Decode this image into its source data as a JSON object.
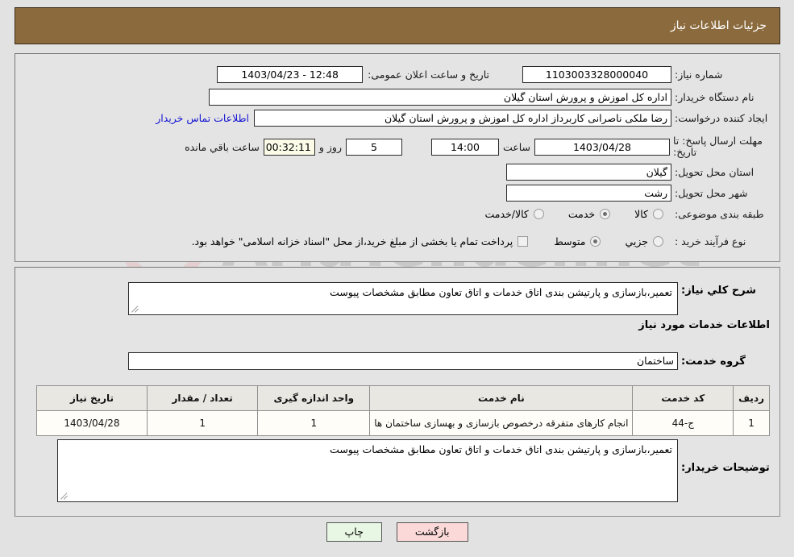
{
  "header": {
    "title": "جزئیات اطلاعات نیاز"
  },
  "watermark": {
    "text": "AriaTender.net",
    "shield_color": "#e8a6a6",
    "text_color": "#8e8e8e"
  },
  "form": {
    "need_number": {
      "label": "شماره نیاز:",
      "value": "1103003328000040"
    },
    "public_announce_datetime": {
      "label": "تاریخ و ساعت اعلان عمومی:",
      "value": "12:48 - 1403/04/23"
    },
    "buyer_org": {
      "label": "نام دستگاه خریدار:",
      "value": "اداره کل اموزش و پرورش استان گیلان"
    },
    "request_creator": {
      "label": "ایجاد کننده درخواست:",
      "value": "رضا ملکی ناصرانی کاربرداز اداره کل اموزش و پرورش استان گیلان"
    },
    "buyer_contact_link": {
      "label": "اطلاعات تماس خریدار"
    },
    "response_deadline": {
      "label": "مهلت ارسال پاسخ: تا تاریخ:",
      "date": "1403/04/28",
      "time_word": "ساعت",
      "time": "14:00",
      "days": "5",
      "days_word": "روز و",
      "timer": "00:32:11",
      "remaining_word": "ساعت باقي مانده"
    },
    "delivery_province": {
      "label": "استان محل تحویل:",
      "value": "گیلان"
    },
    "delivery_city": {
      "label": "شهر محل تحویل:",
      "value": "رشت"
    },
    "subject_category": {
      "label": "طبقه بندی موضوعی:",
      "options": [
        {
          "label": "کالا",
          "checked": false
        },
        {
          "label": "خدمت",
          "checked": true
        },
        {
          "label": "کالا/خدمت",
          "checked": false
        }
      ]
    },
    "purchase_process_type": {
      "label": "نوع فرآیند خرید :",
      "options": [
        {
          "label": "جزیي",
          "checked": false
        },
        {
          "label": "متوسط",
          "checked": true
        }
      ],
      "checkbox": {
        "label": "پرداخت تمام یا بخشی از مبلغ خرید،از محل \"اسناد خزانه اسلامی\" خواهد بود.",
        "checked": false
      }
    }
  },
  "bottom": {
    "general_description": {
      "label": "شرح کلي نیاز:",
      "value": "تعمیر،بازسازی و پارتیشن بندی اتاق خدمات و اتاق تعاون مطابق مشخصات پیوست"
    },
    "services_info_heading": "اطلاعات خدمات مورد نیاز",
    "service_group": {
      "label": "گروه خدمت:",
      "value": "ساختمان"
    },
    "buyer_notes": {
      "label": "توضیحات خریدار:",
      "value": "تعمیر،بازسازی و پارتیشن بندی اتاق خدمات و اتاق تعاون مطابق مشخصات پیوست"
    }
  },
  "table": {
    "columns": [
      "ردیف",
      "کد خدمت",
      "نام خدمت",
      "واحد اندازه گیری",
      "تعداد / مقدار",
      "تاریخ نیاز"
    ],
    "rows": [
      {
        "radif": "1",
        "code": "ج-44",
        "name": "انجام کارهای متفرقه درخصوص بازسازی و بهسازی ساختمان ها",
        "unit": "1",
        "quantity": "1",
        "need_date": "1403/04/28"
      }
    ]
  },
  "buttons": {
    "print": "چاپ",
    "back": "بازگشت"
  }
}
